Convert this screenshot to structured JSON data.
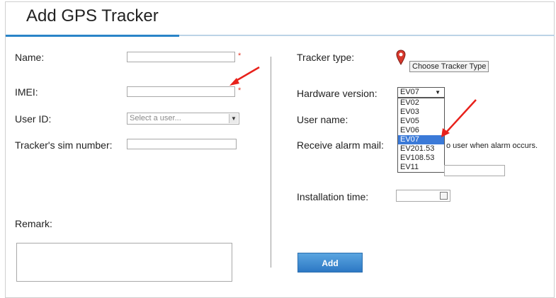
{
  "page": {
    "title": "Add GPS Tracker"
  },
  "left": {
    "name_label": "Name:",
    "imei_label": "IMEI:",
    "user_id_label": "User ID:",
    "user_id_placeholder": "Select a user...",
    "sim_label": "Tracker's sim number:",
    "remark_label": "Remark:",
    "required_marker": "*"
  },
  "right": {
    "tracker_type_label": "Tracker type:",
    "choose_tracker_type_button": "Choose Tracker Type",
    "hardware_version_label": "Hardware version:",
    "hardware_version_selected": "EV07",
    "hardware_version_options": [
      "EV02",
      "EV03",
      "EV05",
      "EV06",
      "EV07",
      "EV201.53",
      "EV108.53",
      "EV11"
    ],
    "user_name_label": "User name:",
    "receive_alarm_label": "Receive alarm mail:",
    "receive_alarm_text": "o user when alarm occurs.",
    "installation_time_label": "Installation time:",
    "add_button": "Add"
  },
  "colors": {
    "accent": "#2a84c8",
    "required": "#e23b2b",
    "selection": "#3b7ad8",
    "annotation_arrow": "#e8211b"
  },
  "icons": {
    "tracker_type_icon": "map-pin-icon",
    "date_icon": "calendar-icon"
  }
}
